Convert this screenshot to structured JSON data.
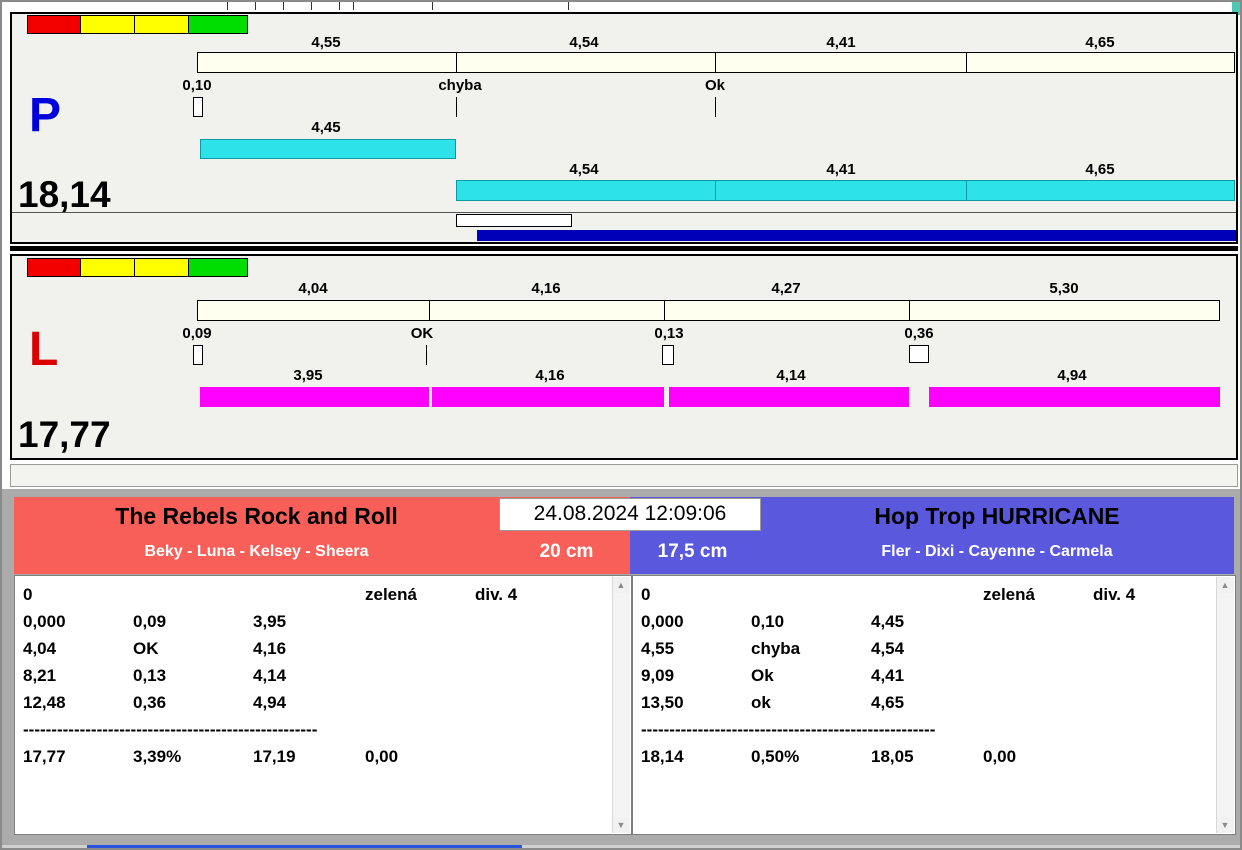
{
  "colors": {
    "cream_bar": "#fffff0",
    "cyan_bar": "#2ee2ea",
    "magenta_bar": "#ff00ff",
    "blue_progress": "#0000b8",
    "team_left_bg": "#f85f58",
    "team_right_bg": "#5a58dd",
    "lane_p_letter": "#0000dd",
    "lane_l_letter": "#dd0000"
  },
  "timestamp": "24.08.2024 12:09:06",
  "lane_p": {
    "label": "P",
    "total": "18,14",
    "split_labels": [
      "4,55",
      "4,54",
      "4,41",
      "4,65"
    ],
    "marker_start": "0,10",
    "marker_fault": "chyba",
    "marker_ok": "Ok",
    "bar1_label": "4,45",
    "bar2_labels": [
      "4,54",
      "4,41",
      "4,65"
    ]
  },
  "lane_l": {
    "label": "L",
    "total": "17,77",
    "split_labels": [
      "4,04",
      "4,16",
      "4,27",
      "5,30"
    ],
    "markers": [
      "0,09",
      "OK",
      "0,13",
      "0,36"
    ],
    "bar_labels": [
      "3,95",
      "4,16",
      "4,14",
      "4,94"
    ]
  },
  "team_left": {
    "name": "The Rebels Rock and Roll",
    "dogs": "Beky - Luna - Kelsey - Sheera",
    "height": "20 cm",
    "log": {
      "run_no": "0",
      "status": "zelená",
      "division": "div. 4",
      "rows": [
        [
          "0,000",
          "0,09",
          "3,95"
        ],
        [
          "4,04",
          "OK",
          "4,16"
        ],
        [
          "8,21",
          "0,13",
          "4,14"
        ],
        [
          "12,48",
          "0,36",
          "4,94"
        ]
      ],
      "divider": "----------------------------------------------------",
      "summary": [
        "17,77",
        "3,39%",
        "17,19",
        "0,00"
      ]
    }
  },
  "team_right": {
    "name": "Hop Trop HURRICANE",
    "dogs": "Fler - Dixi - Cayenne - Carmela",
    "height": "17,5 cm",
    "log": {
      "run_no": "0",
      "status": "zelená",
      "division": "div. 4",
      "rows": [
        [
          "0,000",
          "0,10",
          "4,45"
        ],
        [
          "4,55",
          "chyba",
          "4,54"
        ],
        [
          "9,09",
          "Ok",
          "4,41"
        ],
        [
          "13,50",
          "ok",
          "4,65"
        ]
      ],
      "divider": "----------------------------------------------------",
      "summary": [
        "18,14",
        "0,50%",
        "18,05",
        "0,00"
      ]
    }
  }
}
